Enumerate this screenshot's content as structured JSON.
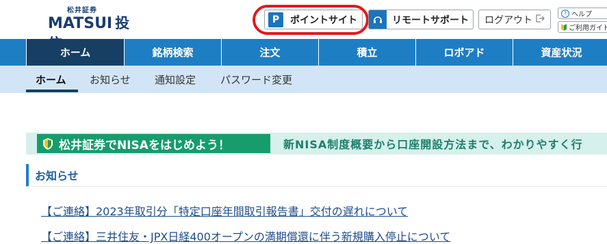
{
  "header": {
    "logo_top": "松井証券",
    "logo_matsui": "MATSUI",
    "logo_sub": "投信",
    "point_badge": "P",
    "point_site": "ポイントサイト",
    "remote_support": "リモートサポート",
    "logout": "ログアウト",
    "help": "ヘルプ",
    "guide": "ご利用ガイド"
  },
  "main_nav": [
    "ホーム",
    "銘柄検索",
    "注文",
    "積立",
    "ロボアド",
    "資産状況"
  ],
  "sub_nav": [
    "ホーム",
    "お知らせ",
    "通知設定",
    "パスワード変更"
  ],
  "banner": {
    "label": "松井証券でNISAをはじめよう！",
    "text": "新NISA制度概要から口座開設方法まで、わかりやすく行"
  },
  "notices": {
    "title": "お知らせ",
    "items": [
      "【ご連絡】2023年取引分「特定口座年間取引報告書」交付の遅れについて",
      "【ご連絡】三井住友・JPX日経400オープンの満期償還に伴う新規購入停止について"
    ]
  },
  "colors": {
    "nav_blue": "#1d7ec4",
    "nav_active": "#163f63",
    "subnav_bg": "#d2e5f6",
    "banner_green": "#169c6d",
    "highlight_red": "#e3191b"
  }
}
